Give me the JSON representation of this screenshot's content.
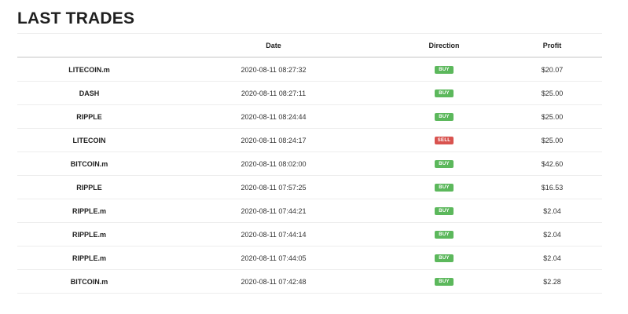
{
  "title": "LAST TRADES",
  "table": {
    "headers": [
      "",
      "Date",
      "Direction",
      "Profit"
    ],
    "rows": [
      {
        "symbol": "LITECOIN.m",
        "date": "2020-08-11 08:27:32",
        "direction": "BUY",
        "profit": "$20.07"
      },
      {
        "symbol": "DASH",
        "date": "2020-08-11 08:27:11",
        "direction": "BUY",
        "profit": "$25.00"
      },
      {
        "symbol": "RIPPLE",
        "date": "2020-08-11 08:24:44",
        "direction": "BUY",
        "profit": "$25.00"
      },
      {
        "symbol": "LITECOIN",
        "date": "2020-08-11 08:24:17",
        "direction": "SELL",
        "profit": "$25.00"
      },
      {
        "symbol": "BITCOIN.m",
        "date": "2020-08-11 08:02:00",
        "direction": "BUY",
        "profit": "$42.60"
      },
      {
        "symbol": "RIPPLE",
        "date": "2020-08-11 07:57:25",
        "direction": "BUY",
        "profit": "$16.53"
      },
      {
        "symbol": "RIPPLE.m",
        "date": "2020-08-11 07:44:21",
        "direction": "BUY",
        "profit": "$2.04"
      },
      {
        "symbol": "RIPPLE.m",
        "date": "2020-08-11 07:44:14",
        "direction": "BUY",
        "profit": "$2.04"
      },
      {
        "symbol": "RIPPLE.m",
        "date": "2020-08-11 07:44:05",
        "direction": "BUY",
        "profit": "$2.04"
      },
      {
        "symbol": "BITCOIN.m",
        "date": "2020-08-11 07:42:48",
        "direction": "BUY",
        "profit": "$2.28"
      }
    ]
  },
  "colors": {
    "buy": "#5cb85c",
    "sell": "#d9534f"
  }
}
